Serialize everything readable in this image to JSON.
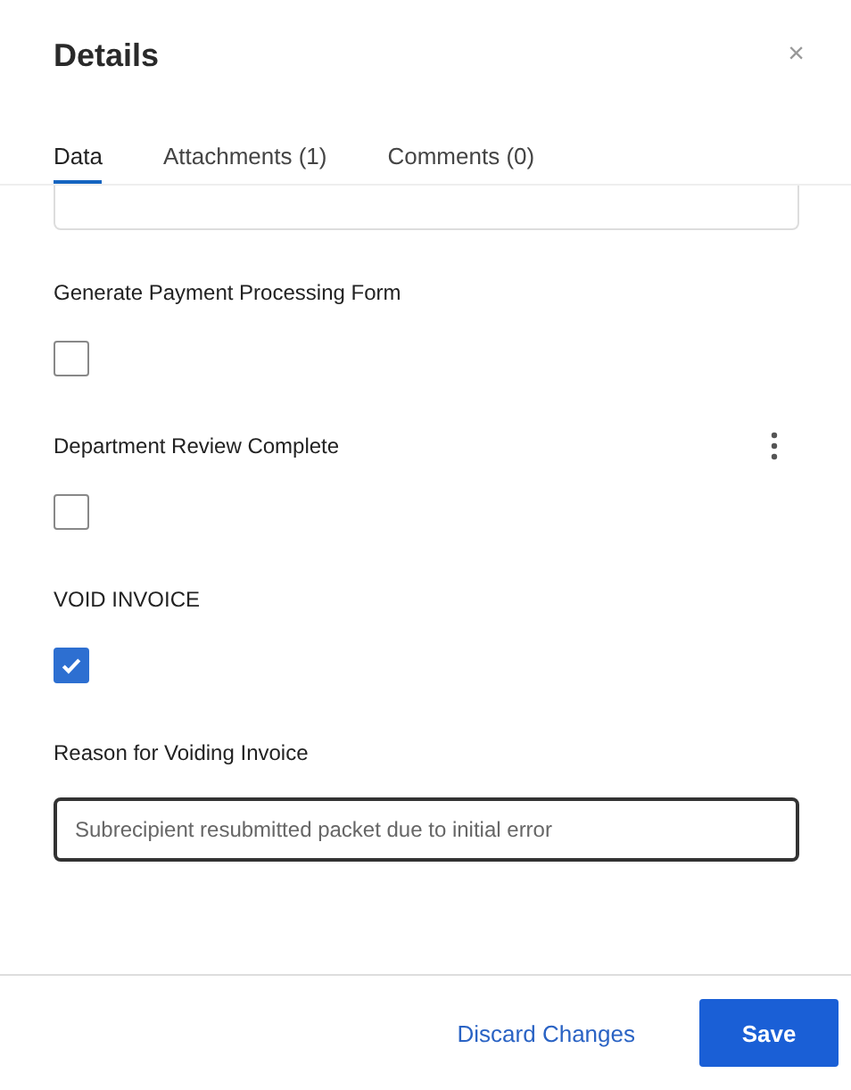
{
  "window": {
    "title": "Details",
    "close": "×"
  },
  "tabs": [
    {
      "label": "Data",
      "selected": true
    },
    {
      "label": "Attachments (1)",
      "selected": false
    },
    {
      "label": "Comments (0)",
      "selected": false
    }
  ],
  "fields": [
    {
      "kind": "checkbox",
      "label": "Generate Payment Processing Form",
      "checked": false,
      "has_menu": false
    },
    {
      "kind": "checkbox",
      "label": "Department Review Complete",
      "checked": false,
      "has_menu": true
    },
    {
      "kind": "checkbox",
      "label": "VOID INVOICE",
      "checked": true,
      "has_menu": false
    },
    {
      "kind": "text",
      "label": "Reason for Voiding Invoice",
      "value": "Subrecipient resubmitted packet due to initial error",
      "has_menu": false
    }
  ],
  "buttons": [
    {
      "kind": "link",
      "label": "Discard Changes"
    },
    {
      "kind": "primary",
      "label": "Save"
    }
  ]
}
